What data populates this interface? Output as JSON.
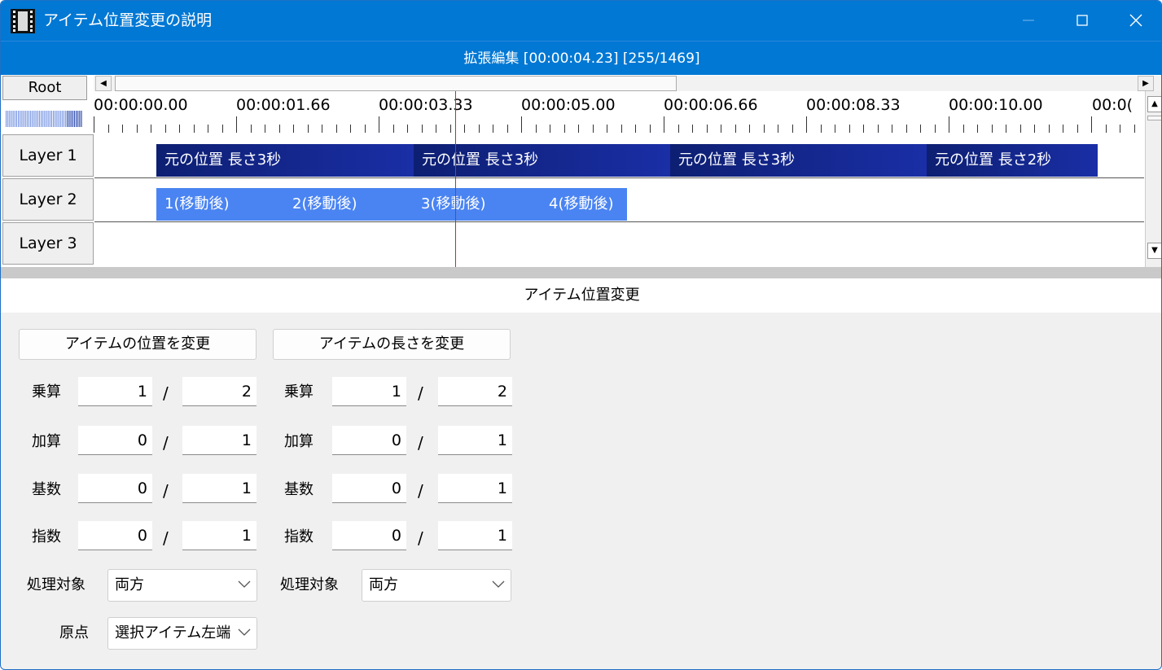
{
  "window": {
    "title": "アイテム位置変更の説明"
  },
  "edit": {
    "title": "拡張編集 [00:00:04.23] [255/1469]"
  },
  "timeline": {
    "root_label": "Root",
    "ruler_labels": [
      "00:00:00.00",
      "00:00:01.66",
      "00:00:03.33",
      "00:00:05.00",
      "00:00:06.66",
      "00:00:08.33",
      "00:00:10.00",
      "00:0("
    ],
    "layers": [
      "Layer 1",
      "Layer 2",
      "Layer 3"
    ],
    "layer1_clips": [
      "元の位置 長さ3秒",
      "元の位置 長さ3秒",
      "元の位置 長さ3秒",
      "元の位置 長さ2秒"
    ],
    "layer2_clips": [
      "1(移動後)",
      "2(移動後)",
      "3(移動後)",
      "4(移動後)"
    ]
  },
  "panel": {
    "title": "アイテム位置変更",
    "position_button": "アイテムの位置を変更",
    "length_button": "アイテムの長さを変更",
    "slash": "/",
    "left": {
      "rows": [
        {
          "label": "乗算",
          "a": "1",
          "b": "2"
        },
        {
          "label": "加算",
          "a": "0",
          "b": "1"
        },
        {
          "label": "基数",
          "a": "0",
          "b": "1"
        },
        {
          "label": "指数",
          "a": "0",
          "b": "1"
        }
      ],
      "target_label": "処理対象",
      "target_value": "両方",
      "origin_label": "原点",
      "origin_value": "選択アイテム左端"
    },
    "right": {
      "rows": [
        {
          "label": "乗算",
          "a": "1",
          "b": "2"
        },
        {
          "label": "加算",
          "a": "0",
          "b": "1"
        },
        {
          "label": "基数",
          "a": "0",
          "b": "1"
        },
        {
          "label": "指数",
          "a": "0",
          "b": "1"
        }
      ],
      "target_label": "処理対象",
      "target_value": "両方"
    }
  },
  "colors": {
    "accent": "#0078d4",
    "clip_dark": "#13238a",
    "clip_light": "#4a84f2",
    "playhead": "#e02020"
  }
}
